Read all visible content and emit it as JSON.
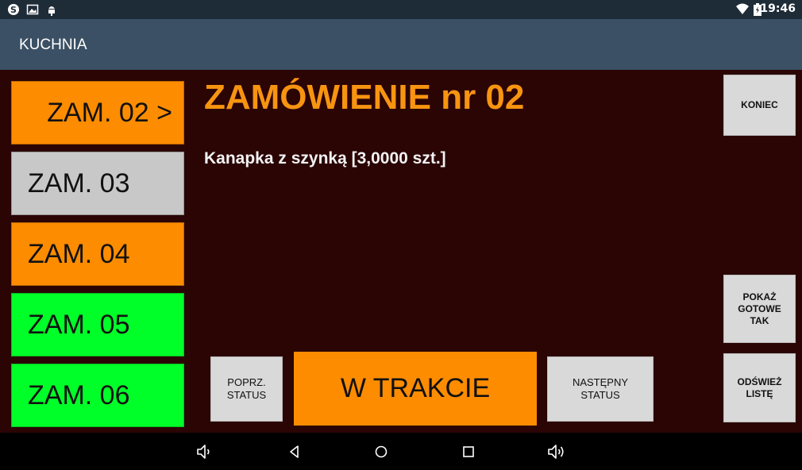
{
  "status_bar": {
    "time": "19:46",
    "left_icons": [
      "skype-icon",
      "image-icon",
      "android-debug-icon"
    ],
    "right_icons": [
      "wifi-icon",
      "battery-icon"
    ]
  },
  "app": {
    "title": "KUCHNIA"
  },
  "orders": [
    {
      "label": "ZAM. 02 >",
      "color": "#fd8c00",
      "selected": true
    },
    {
      "label": "ZAM. 03",
      "color": "#c8c8c8",
      "selected": false
    },
    {
      "label": "ZAM. 04",
      "color": "#fd8c00",
      "selected": false
    },
    {
      "label": "ZAM. 05",
      "color": "#00ff28",
      "selected": false
    },
    {
      "label": "ZAM. 06",
      "color": "#00ff28",
      "selected": false
    }
  ],
  "detail": {
    "heading": "ZAMÓWIENIE nr 02",
    "item_line": "Kanapka z szynką [3,0000 szt.]"
  },
  "buttons": {
    "prev_status": "POPRZ.\nSTATUS",
    "current_status": "W TRAKCIE",
    "next_status": "NASTĘPNY\nSTATUS",
    "end": "KONIEC",
    "show_ready": "POKAŻ\nGOTOWE\nTAK",
    "refresh": "ODŚWIEŻ\nLISTĘ"
  },
  "colors": {
    "content_bg": "#2b0404",
    "heading": "#f79410",
    "status_orange": "#fd8c00",
    "ready_green": "#00ff28",
    "pending_grey": "#c8c8c8"
  },
  "navbar_icons": [
    "volume-down-icon",
    "back-icon",
    "home-icon",
    "recents-icon",
    "volume-up-icon"
  ]
}
